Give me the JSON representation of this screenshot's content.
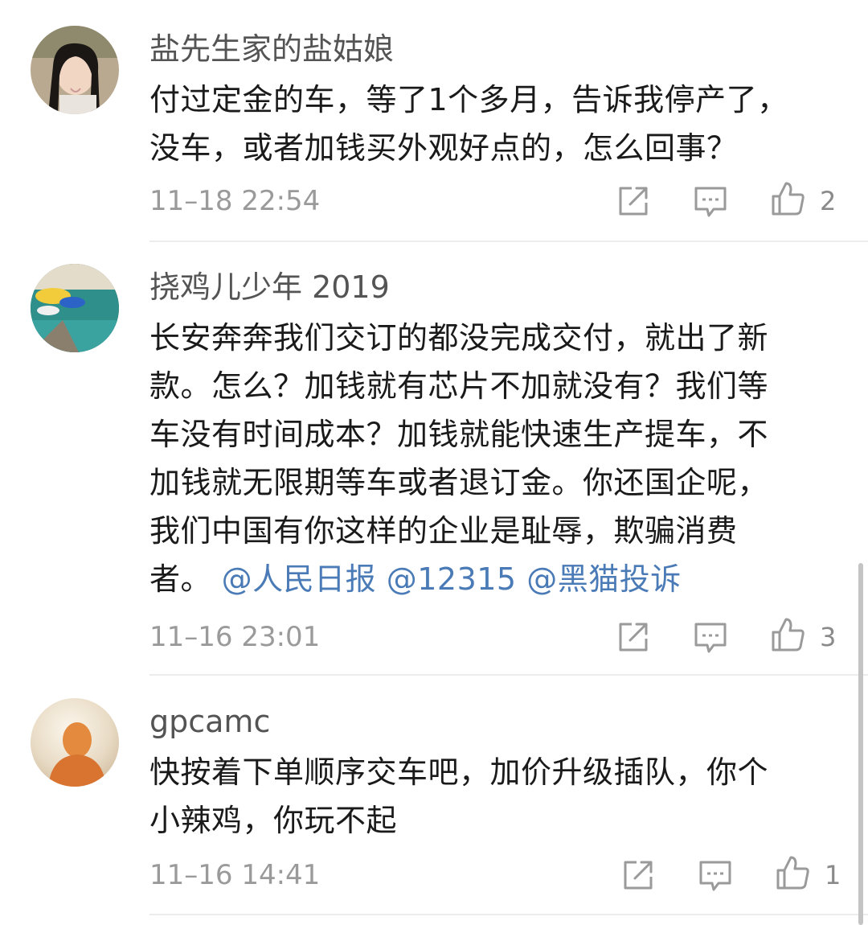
{
  "comments": [
    {
      "username": "盐先生家的盐姑娘",
      "lines": [
        "付过定金的车，等了1个多月，告诉我停产了，",
        "没车，或者加钱买外观好点的，怎么回事？"
      ],
      "time": "11–18 22:54",
      "likes": "2"
    },
    {
      "username": "挠鸡儿少年 2019",
      "lines": [
        "长安奔奔我们交订的都没完成交付，就出了新",
        "款。怎么？加钱就有芯片不加就没有？我们等",
        "车没有时间成本？加钱就能快速生产提车，不",
        "加钱就无限期等车或者退订金。你还国企呢，",
        "我们中国有你这样的企业是耻辱，欺骗消费"
      ],
      "last_line_text": "者。",
      "mentions": [
        "@人民日报",
        "@12315",
        "@黑猫投诉"
      ],
      "time": "11–16 23:01",
      "likes": "3"
    },
    {
      "username": "gpcamc",
      "lines": [
        "快按着下单顺序交车吧，加价升级插队，你个",
        "小辣鸡，你玩不起"
      ],
      "time": "11–16 14:41",
      "likes": "1"
    }
  ],
  "icons": {
    "share": "share-icon",
    "reply": "comment-icon",
    "like": "thumbs-up-icon"
  },
  "colors": {
    "mention": "#4a7bb7",
    "username": "#545454",
    "body": "#1a1a1a",
    "time": "#9a9a9a"
  }
}
